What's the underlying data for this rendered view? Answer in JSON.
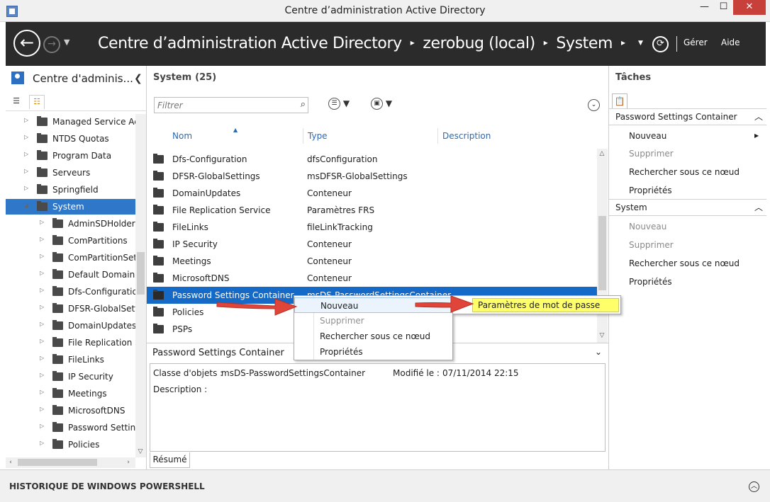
{
  "window": {
    "title": "Centre d’administration Active Directory",
    "min": "—",
    "max": "☐",
    "close": "✕"
  },
  "nav": {
    "crumbs": [
      "Centre d’administration Active Directory",
      "zerobug (local)",
      "System"
    ],
    "sep": "▸",
    "manage": "Gérer",
    "help": "Aide"
  },
  "left": {
    "title": "Centre d'adminis...",
    "tree": [
      {
        "label": "Managed Service Acco",
        "indent": 0,
        "arrow": "▷",
        "kind": "folder"
      },
      {
        "label": "NTDS Quotas",
        "indent": 0,
        "arrow": "▷",
        "kind": "folder"
      },
      {
        "label": "Program Data",
        "indent": 0,
        "arrow": "▷",
        "kind": "folder"
      },
      {
        "label": "Serveurs",
        "indent": 0,
        "arrow": "▷",
        "kind": "ou"
      },
      {
        "label": "Springfield",
        "indent": 0,
        "arrow": "▷",
        "kind": "ou"
      },
      {
        "label": "System",
        "indent": 0,
        "arrow": "◢",
        "kind": "folder",
        "selected": true
      },
      {
        "label": "AdminSDHolder",
        "indent": 1,
        "arrow": "▷",
        "kind": "folder"
      },
      {
        "label": "ComPartitions",
        "indent": 1,
        "arrow": "▷",
        "kind": "folder"
      },
      {
        "label": "ComPartitionSets",
        "indent": 1,
        "arrow": "▷",
        "kind": "folder"
      },
      {
        "label": "Default Domain Po",
        "indent": 1,
        "arrow": "▷",
        "kind": "folder"
      },
      {
        "label": "Dfs-Configuration",
        "indent": 1,
        "arrow": "▷",
        "kind": "folder"
      },
      {
        "label": "DFSR-GlobalSettin",
        "indent": 1,
        "arrow": "▷",
        "kind": "folder"
      },
      {
        "label": "DomainUpdates",
        "indent": 1,
        "arrow": "▷",
        "kind": "folder"
      },
      {
        "label": "File Replication Se",
        "indent": 1,
        "arrow": "▷",
        "kind": "folder"
      },
      {
        "label": "FileLinks",
        "indent": 1,
        "arrow": "▷",
        "kind": "folder"
      },
      {
        "label": "IP Security",
        "indent": 1,
        "arrow": "▷",
        "kind": "folder"
      },
      {
        "label": "Meetings",
        "indent": 1,
        "arrow": "▷",
        "kind": "folder"
      },
      {
        "label": "MicrosoftDNS",
        "indent": 1,
        "arrow": "▷",
        "kind": "folder"
      },
      {
        "label": "Password Settings",
        "indent": 1,
        "arrow": "▷",
        "kind": "folder"
      },
      {
        "label": "Policies",
        "indent": 1,
        "arrow": "▷",
        "kind": "folder"
      },
      {
        "label": "PSPs",
        "indent": 1,
        "arrow": "▷",
        "kind": "folder"
      }
    ]
  },
  "center": {
    "title": "System",
    "count": "(25)",
    "filter_placeholder": "Filtrer",
    "columns": {
      "name": "Nom",
      "type": "Type",
      "description": "Description"
    },
    "rows": [
      {
        "name": "Dfs-Configuration",
        "type": "dfsConfiguration"
      },
      {
        "name": "DFSR-GlobalSettings",
        "type": "msDFSR-GlobalSettings"
      },
      {
        "name": "DomainUpdates",
        "type": "Conteneur"
      },
      {
        "name": "File Replication Service",
        "type": "Paramètres FRS"
      },
      {
        "name": "FileLinks",
        "type": "fileLinkTracking"
      },
      {
        "name": "IP Security",
        "type": "Conteneur"
      },
      {
        "name": "Meetings",
        "type": "Conteneur"
      },
      {
        "name": "MicrosoftDNS",
        "type": "Conteneur"
      },
      {
        "name": "Password Settings Container",
        "type": "msDS-PasswordSettingsContainer",
        "selected": true
      },
      {
        "name": "Policies",
        "type": ""
      },
      {
        "name": "PSPs",
        "type": ""
      }
    ],
    "details": {
      "title": "Password Settings Container",
      "class_label": "Classe d'objets :",
      "class_value": "msDS-PasswordSettingsContainer",
      "modified_label": "Modifié le :",
      "modified_value": "07/11/2014 22:15",
      "description_label": "Description :",
      "tab": "Résumé"
    }
  },
  "context_menu": {
    "items": [
      {
        "label": "Nouveau",
        "highlight": true,
        "submenu": true
      },
      {
        "label": "Supprimer",
        "disabled": true
      },
      {
        "label": "Rechercher sous ce nœud"
      },
      {
        "label": "Propriétés"
      }
    ],
    "submenu_item": "Paramètres de mot de passe"
  },
  "right": {
    "title": "Tâches",
    "sections": [
      {
        "title": "Password Settings Container",
        "items": [
          {
            "label": "Nouveau",
            "submenu": true
          },
          {
            "label": "Supprimer",
            "disabled": true
          },
          {
            "label": "Rechercher sous ce nœud"
          },
          {
            "label": "Propriétés"
          }
        ]
      },
      {
        "title": "System",
        "items": [
          {
            "label": "Nouveau",
            "disabled": true
          },
          {
            "label": "Supprimer",
            "disabled": true
          },
          {
            "label": "Rechercher sous ce nœud"
          },
          {
            "label": "Propriétés"
          }
        ]
      }
    ]
  },
  "bottom": {
    "title": "HISTORIQUE DE WINDOWS POWERSHELL"
  },
  "colors": {
    "accent": "#1569c7",
    "titlebar_close": "#c7403a",
    "nav_bg": "#2b2b2b",
    "arrow_red": "#e0453a",
    "highlight_yellow": "#ffff6a"
  }
}
